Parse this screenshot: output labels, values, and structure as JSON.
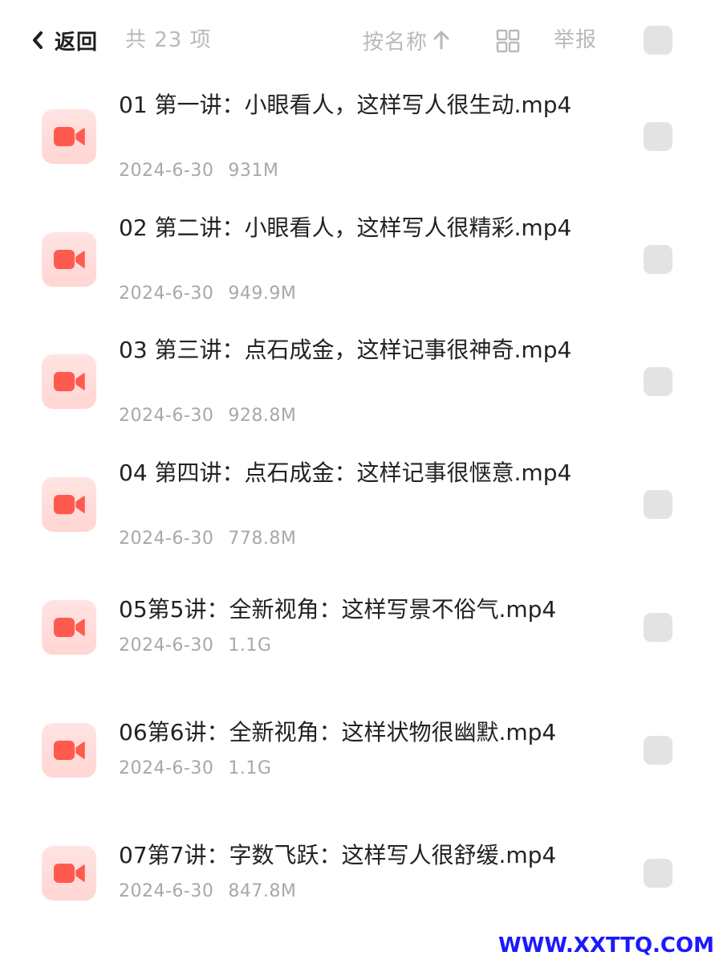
{
  "header": {
    "back_label": "返回",
    "count_label": "共 23 项",
    "sort_label": "按名称",
    "report_label": "举报",
    "icons": {
      "back": "chevron-left-icon",
      "sort": "arrow-up-icon",
      "grid": "grid-view-icon"
    }
  },
  "files": [
    {
      "name": "01 第一讲：小眼看人，这样写人很生动.mp4",
      "date": "2024-6-30",
      "size": "931M",
      "icon": "video-camera-icon"
    },
    {
      "name": "02 第二讲：小眼看人，这样写人很精彩.mp4",
      "date": "2024-6-30",
      "size": "949.9M",
      "icon": "video-camera-icon"
    },
    {
      "name": "03 第三讲：点石成金，这样记事很神奇.mp4",
      "date": "2024-6-30",
      "size": "928.8M",
      "icon": "video-camera-icon"
    },
    {
      "name": "04 第四讲：点石成金：这样记事很惬意.mp4",
      "date": "2024-6-30",
      "size": "778.8M",
      "icon": "video-camera-icon"
    },
    {
      "name": "05第5讲：全新视角：这样写景不俗气.mp4",
      "date": "2024-6-30",
      "size": "1.1G",
      "icon": "video-camera-icon"
    },
    {
      "name": "06第6讲：全新视角：这样状物很幽默.mp4",
      "date": "2024-6-30",
      "size": "1.1G",
      "icon": "video-camera-icon"
    },
    {
      "name": "07第7讲：字数飞跃：这样写人很舒缓.mp4",
      "date": "2024-6-30",
      "size": "847.8M",
      "icon": "video-camera-icon"
    }
  ],
  "watermark": "WWW.XXTTQ.COM",
  "colors": {
    "accent": "#ff5a4e",
    "icon_bg": "#ffe1df",
    "muted_text": "#b9b9b9",
    "meta_text": "#a8a8a8",
    "checkbox": "#e3e3e3",
    "watermark": "#1a1aff"
  }
}
